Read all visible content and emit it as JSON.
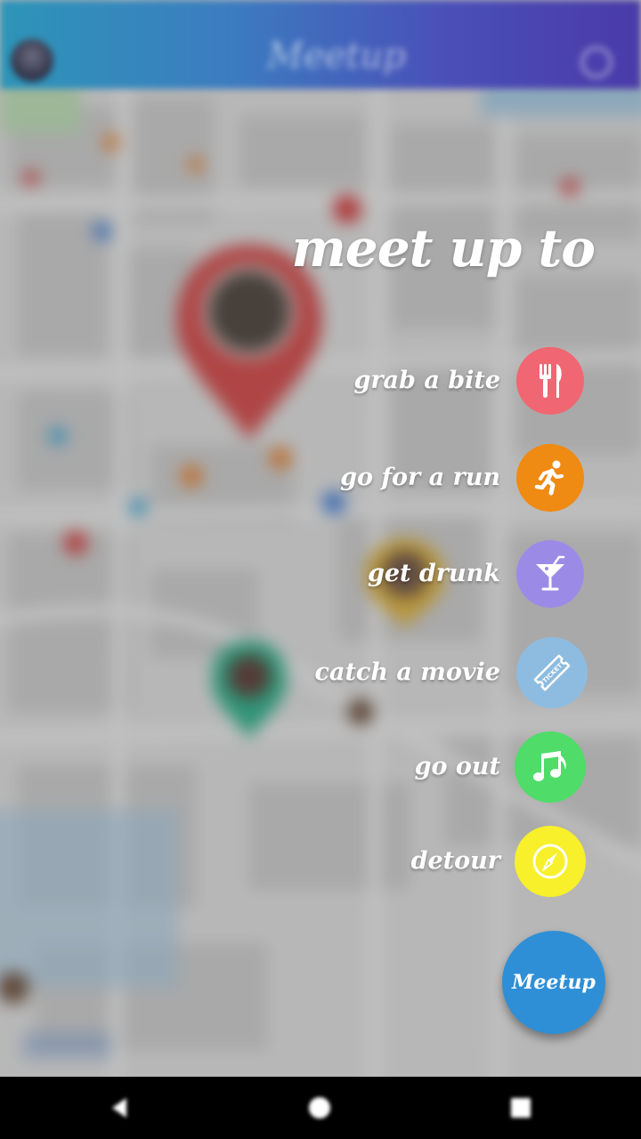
{
  "app": {
    "brand": "Meetup"
  },
  "status_bar": {
    "time": ""
  },
  "overlay": {
    "title": "meet up to",
    "options": [
      {
        "label": "grab a bite",
        "icon": "fork-knife-icon",
        "color": "#f06672"
      },
      {
        "label": "go for a run",
        "icon": "running-person-icon",
        "color": "#ef8a13"
      },
      {
        "label": "get drunk",
        "icon": "cocktail-icon",
        "color": "#9c8be6"
      },
      {
        "label": "catch a movie",
        "icon": "ticket-icon",
        "color": "#8dbce0"
      },
      {
        "label": "go out",
        "icon": "music-notes-icon",
        "color": "#4fdc68"
      },
      {
        "label": "detour",
        "icon": "compass-icon",
        "color": "#f7f02a"
      }
    ],
    "ticket_text": "TICKET",
    "fab_label": "Meetup"
  },
  "colors": {
    "appbar_start": "#2d95b8",
    "appbar_end": "#4a3aa8",
    "fab": "#2f8fd6"
  }
}
